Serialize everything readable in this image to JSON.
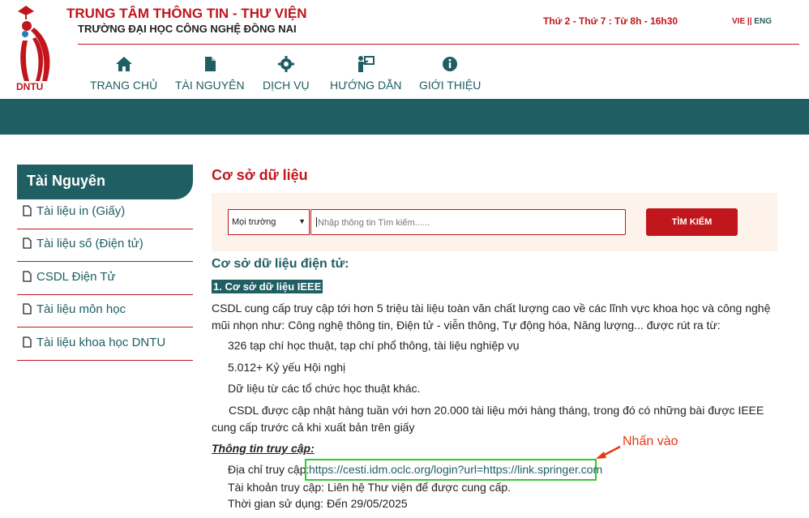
{
  "header": {
    "logo_text": "DNTU",
    "title": "TRUNG TÂM THÔNG TIN - THƯ VIỆN",
    "subtitle": "TRƯỜNG ĐẠI HỌC CÔNG NGHỆ ĐỒNG NAI",
    "hours": "Thứ 2 - Thứ 7 : Từ 8h - 16h30",
    "lang_vie": "VIE",
    "lang_sep": "||",
    "lang_eng": "ENG"
  },
  "nav": [
    {
      "label": "TRANG CHỦ",
      "icon": "home-icon"
    },
    {
      "label": "TÀI NGUYÊN",
      "icon": "file-icon"
    },
    {
      "label": "DỊCH VỤ",
      "icon": "gear-icon"
    },
    {
      "label": "HƯỚNG DẪN",
      "icon": "presenter-icon"
    },
    {
      "label": "GIỚI THIỆU",
      "icon": "info-icon"
    }
  ],
  "sidebar": {
    "title": "Tài Nguyên",
    "items": [
      {
        "label": "Tài liệu in (Giấy)"
      },
      {
        "label": "Tài liệu số (Điện tử)"
      },
      {
        "label": "CSDL Điện Tử"
      },
      {
        "label": "Tài liệu môn học"
      },
      {
        "label": "Tài liệu khoa học DNTU"
      }
    ]
  },
  "main": {
    "heading": "Cơ sở dữ liệu",
    "search": {
      "select_value": "Mọi trường",
      "placeholder": "Nhập thông tin Tìm kiếm......",
      "button": "TÌM KIẾM"
    },
    "section_title": "Cơ sở dữ liệu điện tử:",
    "db_title": "1. Cơ sở dữ liệu IEEE",
    "intro": "CSDL cung cấp truy cập tới hơn 5 triệu tài liệu toàn văn chất lượng cao về các lĩnh vực khoa học và công nghệ mũi nhọn như: Công nghệ thông tin, Điện tử - viễn thông, Tự động hóa, Năng lượng... được rút ra từ:",
    "bullets": [
      "326 tạp chí học thuật, tạp chí phổ thông, tài liệu nghiệp vụ",
      "5.012+ Kỷ yếu Hội nghị",
      "Dữ liệu từ các tổ chức học thuật khác."
    ],
    "update_note": "CSDL được cập nhật hàng tuần với hơn 20.000 tài liệu mới hàng tháng, trong đó có những bài được IEEE cung cấp trước cả khi xuất bản trên giấy",
    "access_title": "Thông tin truy cập:",
    "access_addr_label": "Địa chỉ truy cập:",
    "access_url": "https://cesti.idm.oclc.org/login?url=https://link.springer.com",
    "access_account": "Tài khoản truy cập: Liên hệ Thư viện để được cung cấp.",
    "access_time": "Thời gian sử dụng: Đến 29/05/2025",
    "annotation": "Nhấn vào"
  },
  "colors": {
    "brand_red": "#c0161c",
    "brand_teal": "#1f5e63",
    "highlight_green": "#2ecc2e",
    "annotation_red": "#e53912"
  }
}
